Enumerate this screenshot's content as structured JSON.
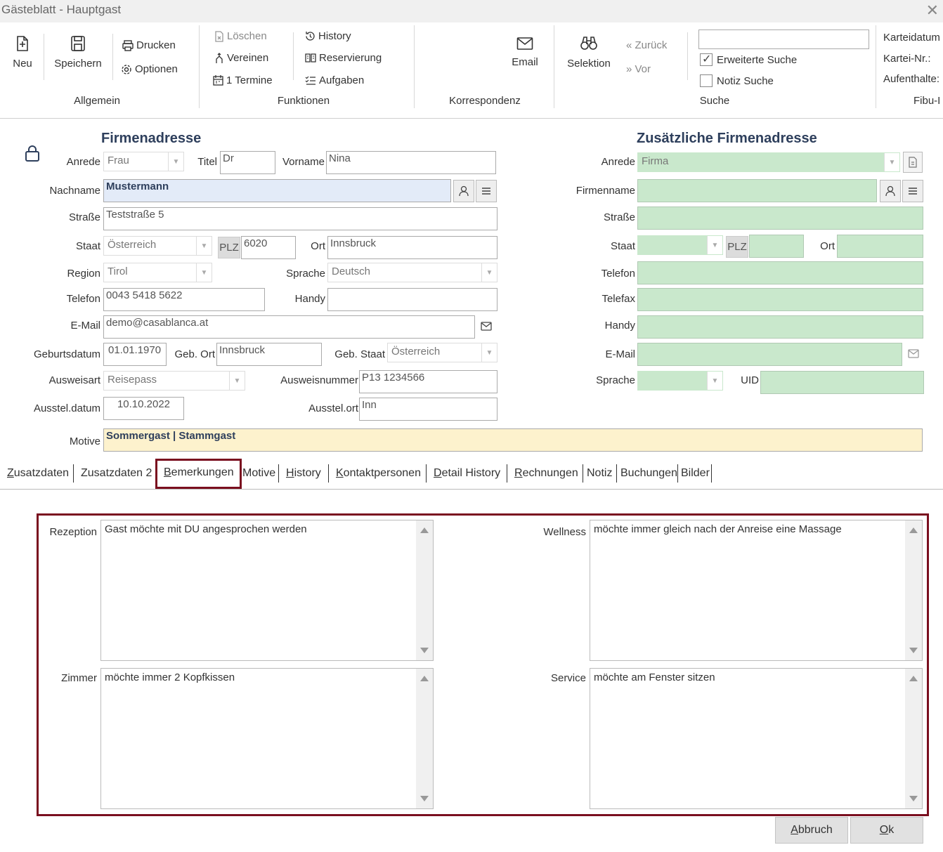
{
  "window": {
    "title": "Gästeblatt - Hauptgast",
    "close": "✕"
  },
  "ribbon": {
    "allgemein": {
      "neu": "Neu",
      "speichern": "Speichern",
      "drucken": "Drucken",
      "optionen": "Optionen",
      "label": "Allgemein"
    },
    "funktionen": {
      "loeschen": "Löschen",
      "vereinen": "Vereinen",
      "termine": "1 Termine",
      "history": "History",
      "reservierung": "Reservierung",
      "aufgaben": "Aufgaben",
      "label": "Funktionen"
    },
    "korrespondenz": {
      "email": "Email",
      "label": "Korrespondenz"
    },
    "suche": {
      "selektion": "Selektion",
      "zurueck": "« Zurück",
      "vor": "» Vor",
      "input_value": "",
      "erweiterte_suche": "Erweiterte Suche",
      "erweiterte_checked": true,
      "notiz_suche": "Notiz Suche",
      "notiz_checked": false,
      "label": "Suche"
    },
    "kartei": {
      "karteidatum": "Karteidatum",
      "kartei_nr": "Kartei-Nr.:",
      "aufenthalte": "Aufenthalte:",
      "fibu": "Fibu-I"
    }
  },
  "firma": {
    "title": "Firmenadresse",
    "labels": {
      "anrede": "Anrede",
      "titel": "Titel",
      "vorname": "Vorname",
      "nachname": "Nachname",
      "strasse": "Straße",
      "staat": "Staat",
      "plz": "PLZ",
      "ort": "Ort",
      "region": "Region",
      "sprache": "Sprache",
      "telefon": "Telefon",
      "handy": "Handy",
      "email": "E-Mail",
      "geburtsdatum": "Geburtsdatum",
      "geb_ort": "Geb. Ort",
      "geb_staat": "Geb. Staat",
      "ausweisart": "Ausweisart",
      "ausweisnummer": "Ausweisnummer",
      "ausstel_datum": "Ausstel.datum",
      "ausstel_ort": "Ausstel.ort",
      "motive": "Motive"
    },
    "values": {
      "anrede": "Frau",
      "titel": "Dr",
      "vorname": "Nina",
      "nachname": "Mustermann",
      "strasse": "Teststraße 5",
      "staat": "Österreich",
      "plz": "6020",
      "ort": "Innsbruck",
      "region": "Tirol",
      "sprache": "Deutsch",
      "telefon": "0043 5418 5622",
      "handy": "",
      "email": "demo@casablanca.at",
      "geburtsdatum": "01.01.1970",
      "geb_ort": "Innsbruck",
      "geb_staat": "Österreich",
      "ausweisart": "Reisepass",
      "ausweisnummer": "P13 1234566",
      "ausstel_datum": "10.10.2022",
      "ausstel_ort": "Inn",
      "motive": "Sommergast | Stammgast"
    }
  },
  "zusatz": {
    "title": "Zusätzliche Firmenadresse",
    "labels": {
      "anrede": "Anrede",
      "firmenname": "Firmenname",
      "strasse": "Straße",
      "staat": "Staat",
      "plz": "PLZ",
      "ort": "Ort",
      "telefon": "Telefon",
      "telefax": "Telefax",
      "handy": "Handy",
      "email": "E-Mail",
      "sprache": "Sprache",
      "uid": "UID"
    },
    "values": {
      "anrede": "Firma",
      "firmenname": "",
      "strasse": "",
      "staat": "",
      "plz": "",
      "ort": "",
      "telefon": "",
      "telefax": "",
      "handy": "",
      "email": "",
      "sprache": "",
      "uid": ""
    }
  },
  "tabs": [
    {
      "label": "Zusatzdaten",
      "ul": "Z",
      "rest": "usatzdaten"
    },
    {
      "label": "Zusatzdaten 2",
      "ul": "",
      "rest": ""
    },
    {
      "label": "Bemerkungen",
      "ul": "B",
      "rest": "emerkungen"
    },
    {
      "label": "Motive"
    },
    {
      "label": "History",
      "ul": "H",
      "rest": "istory"
    },
    {
      "label": "Kontaktpersonen",
      "ul": "K",
      "rest": "ontaktpersonen"
    },
    {
      "label": "Detail History",
      "ul": "D",
      "rest": "etail History"
    },
    {
      "label": "Rechnungen",
      "ul": "R",
      "rest": "echnungen"
    },
    {
      "label": "Notiz"
    },
    {
      "label": "Buchungen"
    },
    {
      "label": "Bilder"
    }
  ],
  "active_tab": "Bemerkungen",
  "bemerkungen": {
    "rezeption": {
      "label": "Rezeption",
      "text": "Gast möchte mit DU angesprochen werden"
    },
    "wellness": {
      "label": "Wellness",
      "text": "möchte immer gleich nach der Anreise eine Massage"
    },
    "zimmer": {
      "label": "Zimmer",
      "text": "möchte immer 2 Kopfkissen"
    },
    "service": {
      "label": "Service",
      "text": "möchte am Fenster sitzen"
    }
  },
  "buttons": {
    "abbruch_ul": "A",
    "abbruch_rest": "bbruch",
    "ok_ul": "O",
    "ok_rest": "k"
  },
  "colors": {
    "accent": "#7a0f1f",
    "green_field": "#c9e8cc",
    "title": "#2e3f5c",
    "motive_bg": "#fdf2cd",
    "nachname_bg": "#e3ebf8"
  }
}
